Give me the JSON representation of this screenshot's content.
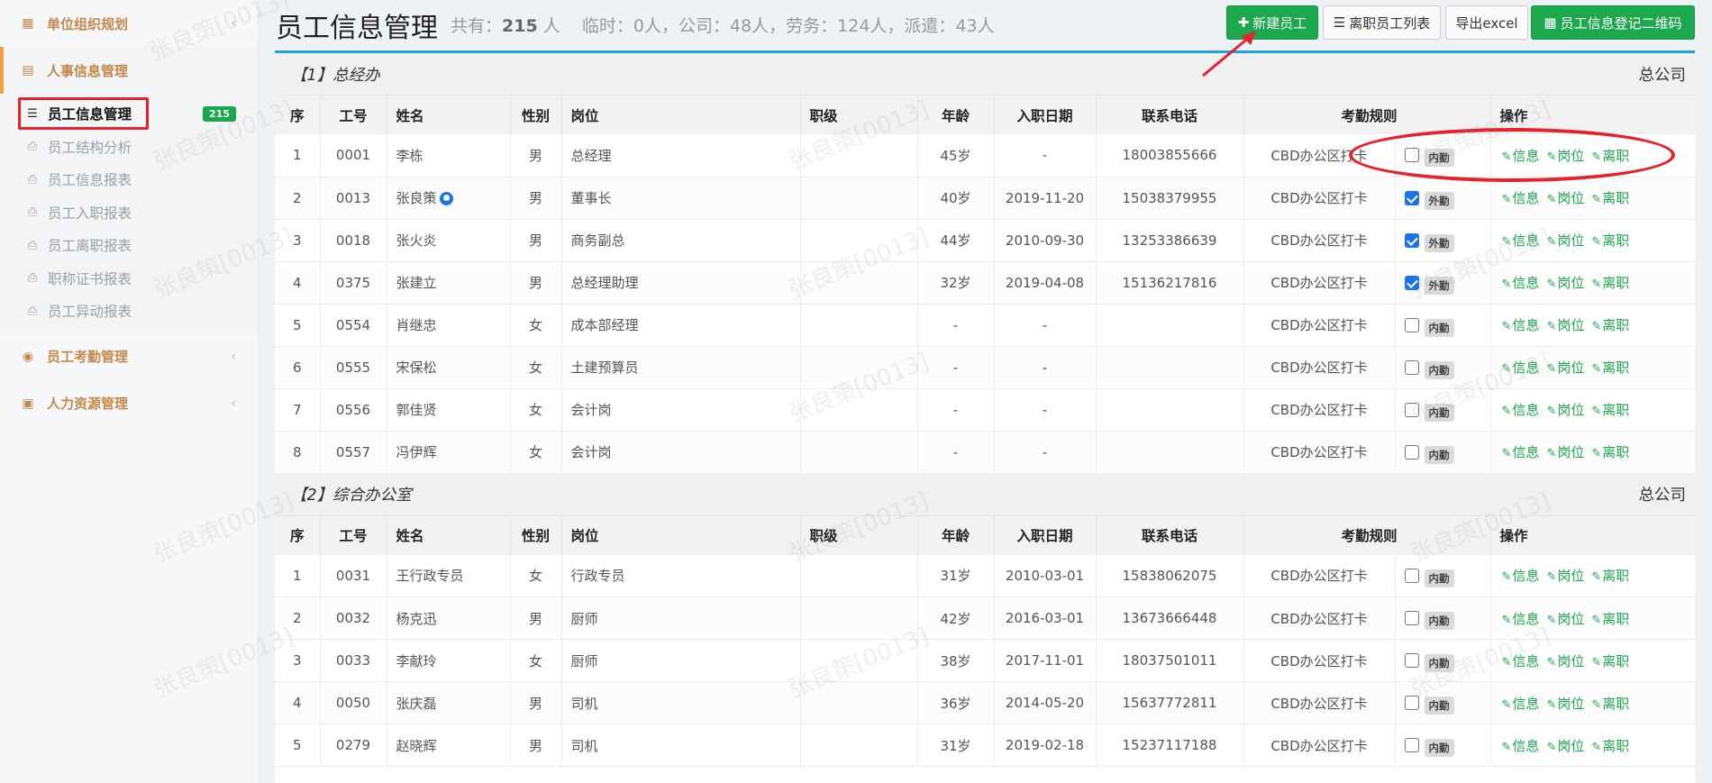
{
  "sidebar": {
    "groups": [
      {
        "label": "单位组织规划",
        "icon": "map-icon"
      },
      {
        "label": "人事信息管理",
        "icon": "id-card-icon"
      },
      {
        "label": "员工考勤管理",
        "icon": "user-circle-icon"
      },
      {
        "label": "人力资源管理",
        "icon": "calendar-icon"
      }
    ],
    "submenu": [
      {
        "label": "员工信息管理",
        "badge": "215"
      },
      {
        "label": "员工结构分析"
      },
      {
        "label": "员工信息报表"
      },
      {
        "label": "员工入职报表"
      },
      {
        "label": "员工离职报表"
      },
      {
        "label": "职称证书报表"
      },
      {
        "label": "员工异动报表"
      }
    ]
  },
  "header": {
    "title": "员工信息管理",
    "summary_prefix": "共有：",
    "total": "215",
    "summary_suffix": " 人    临时：0人，公司：48人，劳务：124人，派遣：43人",
    "buttons": {
      "new_employee": "新建员工",
      "resigned_list": "离职员工列表",
      "export_excel": "导出excel",
      "qr_code": "员工信息登记二维码"
    }
  },
  "table_headers": [
    "序",
    "工号",
    "姓名",
    "性别",
    "岗位",
    "职级",
    "年龄",
    "入职日期",
    "联系电话",
    "考勤规则",
    "操作"
  ],
  "ops": {
    "info": "信息",
    "post": "岗位",
    "resign": "离职"
  },
  "departments": [
    {
      "name": "【1】总经办",
      "company": "总公司",
      "rows": [
        [
          "1",
          "0001",
          "李栋",
          "男",
          "总经理",
          "",
          "45岁",
          "-",
          "18003855666",
          "CBD办公区打卡",
          false,
          "内勤"
        ],
        [
          "2",
          "0013",
          "张良策",
          "男",
          "董事长",
          "",
          "40岁",
          "2019-11-20",
          "15038379955",
          "CBD办公区打卡",
          true,
          "外勤"
        ],
        [
          "3",
          "0018",
          "张火炎",
          "男",
          "商务副总",
          "",
          "44岁",
          "2010-09-30",
          "13253386639",
          "CBD办公区打卡",
          true,
          "外勤"
        ],
        [
          "4",
          "0375",
          "张建立",
          "男",
          "总经理助理",
          "",
          "32岁",
          "2019-04-08",
          "15136217816",
          "CBD办公区打卡",
          true,
          "外勤"
        ],
        [
          "5",
          "0554",
          "肖继忠",
          "女",
          "成本部经理",
          "",
          "-",
          "-",
          "",
          "CBD办公区打卡",
          false,
          "内勤"
        ],
        [
          "6",
          "0555",
          "宋保松",
          "女",
          "土建预算员",
          "",
          "-",
          "-",
          "",
          "CBD办公区打卡",
          false,
          "内勤"
        ],
        [
          "7",
          "0556",
          "郭佳贤",
          "女",
          "会计岗",
          "",
          "-",
          "-",
          "",
          "CBD办公区打卡",
          false,
          "内勤"
        ],
        [
          "8",
          "0557",
          "冯伊辉",
          "女",
          "会计岗",
          "",
          "-",
          "-",
          "",
          "CBD办公区打卡",
          false,
          "内勤"
        ]
      ]
    },
    {
      "name": "【2】综合办公室",
      "company": "总公司",
      "rows": [
        [
          "1",
          "0031",
          "王行政专员",
          "女",
          "行政专员",
          "",
          "31岁",
          "2010-03-01",
          "15838062075",
          "CBD办公区打卡",
          false,
          "内勤"
        ],
        [
          "2",
          "0032",
          "杨克迅",
          "男",
          "厨师",
          "",
          "42岁",
          "2016-03-01",
          "13673666448",
          "CBD办公区打卡",
          false,
          "内勤"
        ],
        [
          "3",
          "0033",
          "李献玲",
          "女",
          "厨师",
          "",
          "38岁",
          "2017-11-01",
          "18037501011",
          "CBD办公区打卡",
          false,
          "内勤"
        ],
        [
          "4",
          "0050",
          "张庆磊",
          "男",
          "司机",
          "",
          "36岁",
          "2014-05-20",
          "15637772811",
          "CBD办公区打卡",
          false,
          "内勤"
        ],
        [
          "5",
          "0279",
          "赵晓辉",
          "男",
          "司机",
          "",
          "31岁",
          "2019-02-18",
          "15237117188",
          "CBD办公区打卡",
          false,
          "内勤"
        ]
      ]
    }
  ],
  "watermark": "张良策[0013]"
}
